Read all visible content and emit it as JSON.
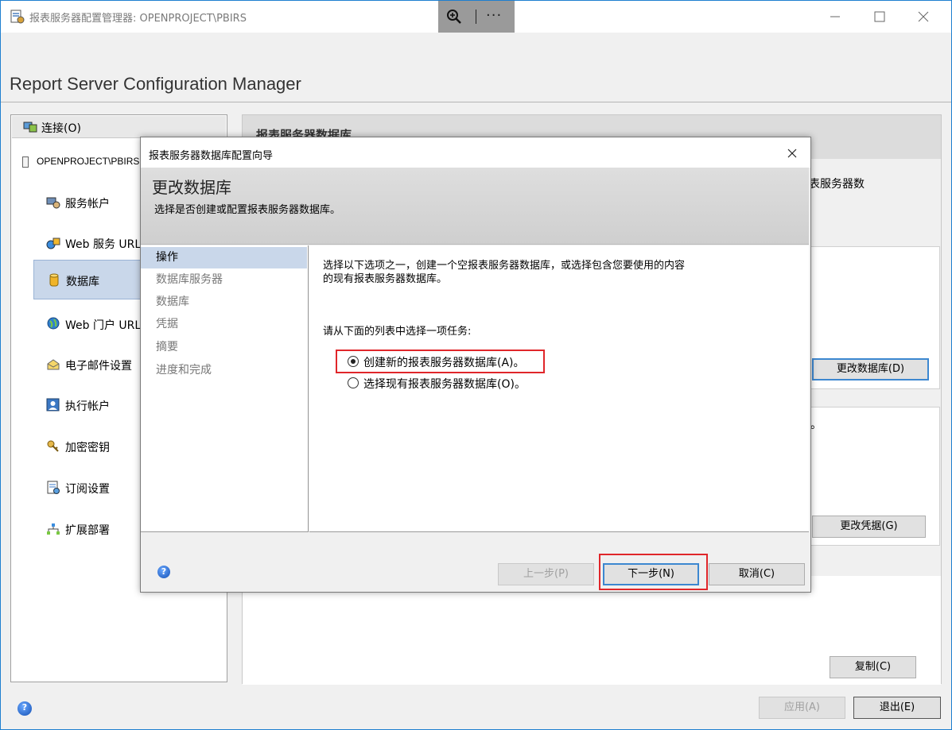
{
  "window": {
    "title": "报表服务器配置管理器: OPENPROJECT\\PBIRS",
    "header_title": "Report Server Configuration Manager",
    "more_label": "···"
  },
  "nav": {
    "connect_label": "连接(O)",
    "server_name": "OPENPROJECT\\PBIRS",
    "items": [
      {
        "label": "服务帐户",
        "icon": "service-account-icon"
      },
      {
        "label": "Web 服务 URL",
        "icon": "web-service-icon"
      },
      {
        "label": "数据库",
        "icon": "database-icon",
        "selected": true
      },
      {
        "label": "Web 门户 URL",
        "icon": "globe-icon"
      },
      {
        "label": "电子邮件设置",
        "icon": "email-icon"
      },
      {
        "label": "执行帐户",
        "icon": "execution-account-icon"
      },
      {
        "label": "加密密钥",
        "icon": "key-icon"
      },
      {
        "label": "订阅设置",
        "icon": "subscription-icon"
      },
      {
        "label": "扩展部署",
        "icon": "scale-out-icon"
      }
    ]
  },
  "right": {
    "title": "报表服务器数据库",
    "desc_fragment": "表服务器数",
    "change_db_button": "更改数据库(D)",
    "period_fragment": "。",
    "change_cred_button": "更改凭据(G)",
    "copy_button": "复制(C)"
  },
  "footer": {
    "apply_button": "应用(A)",
    "exit_button": "退出(E)"
  },
  "dialog": {
    "title": "报表服务器数据库配置向导",
    "heading": "更改数据库",
    "subheading": "选择是否创建或配置报表服务器数据库。",
    "steps": [
      "操作",
      "数据库服务器",
      "数据库",
      "凭据",
      "摘要",
      "进度和完成"
    ],
    "active_step": 0,
    "intro_line1": "选择以下选项之一，创建一个空报表服务器数据库，或选择包含您要使用的内容",
    "intro_line2": "的现有报表服务器数据库。",
    "prompt": "请从下面的列表中选择一项任务:",
    "options": [
      {
        "label": "创建新的报表服务器数据库(A)。",
        "selected": true
      },
      {
        "label": "选择现有报表服务器数据库(O)。",
        "selected": false
      }
    ],
    "back_button": "上一步(P)",
    "next_button": "下一步(N)",
    "cancel_button": "取消(C)"
  },
  "colors": {
    "highlight_box": "#e0262a",
    "selection": "#c9d7ea",
    "focus_border": "#3c87d0"
  }
}
